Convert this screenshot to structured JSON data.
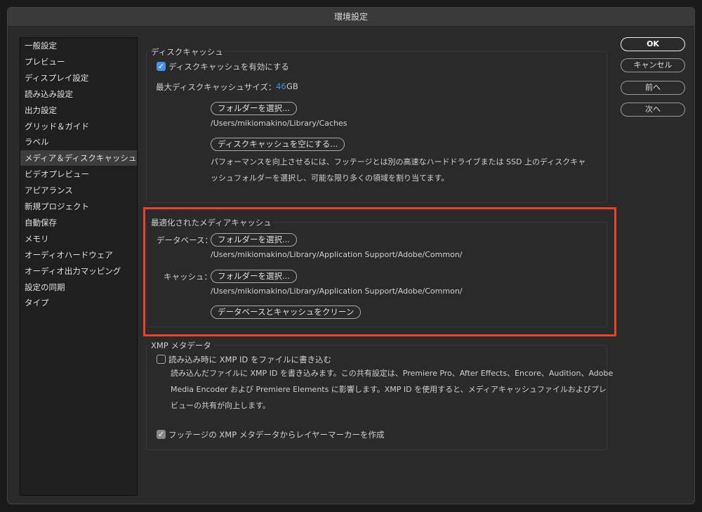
{
  "window": {
    "title": "環境設定"
  },
  "sidebar": {
    "items": [
      {
        "label": "一般設定"
      },
      {
        "label": "プレビュー"
      },
      {
        "label": "ディスプレイ設定"
      },
      {
        "label": "読み込み設定"
      },
      {
        "label": "出力設定"
      },
      {
        "label": "グリッド＆ガイド"
      },
      {
        "label": "ラベル"
      },
      {
        "label": "メディア＆ディスクキャッシュ",
        "selected": true
      },
      {
        "label": "ビデオプレビュー"
      },
      {
        "label": "アピアランス"
      },
      {
        "label": "新規プロジェクト"
      },
      {
        "label": "自動保存"
      },
      {
        "label": "メモリ"
      },
      {
        "label": "オーディオハードウェア"
      },
      {
        "label": "オーディオ出力マッピング"
      },
      {
        "label": "設定の同期"
      },
      {
        "label": "タイプ"
      }
    ]
  },
  "buttons": {
    "ok": "OK",
    "cancel": "キャンセル",
    "prev": "前へ",
    "next": "次へ"
  },
  "disk_cache": {
    "title": "ディスクキャッシュ",
    "enable_label": "ディスクキャッシュを有効にする",
    "enabled": true,
    "max_size_label": "最大ディスクキャッシュサイズ：",
    "max_size_value": "46",
    "max_size_unit": "GB",
    "choose_folder": "フォルダーを選択...",
    "folder_path": "/Users/mikiomakino/Library/Caches",
    "empty_button": "ディスクキャッシュを空にする...",
    "hint_line1": "パフォーマンスを向上させるには、フッテージとは別の高速なハードドライブまたは SSD 上のディスクキャ",
    "hint_line2": "ッシュフォルダーを選択し、可能な限り多くの領域を割り当てます。"
  },
  "optimized": {
    "title": "最適化されたメディアキャッシュ",
    "db_label": "データベース：",
    "db_button": "フォルダーを選択...",
    "db_path": "/Users/mikiomakino/Library/Application Support/Adobe/Common/",
    "cache_label": "キャッシュ：",
    "cache_button": "フォルダーを選択...",
    "cache_path": "/Users/mikiomakino/Library/Application Support/Adobe/Common/",
    "clean_button": "データベースとキャッシュをクリーン"
  },
  "xmp": {
    "title": "XMP メタデータ",
    "write_label": "読み込み時に XMP ID をファイルに書き込む",
    "write_checked": false,
    "desc_line1": "読み込んだファイルに XMP ID を書き込みます。この共有設定は、Premiere Pro、After Effects、Encore、Audition、Adobe",
    "desc_line2": "Media Encoder および Premiere Elements に影響します。XMP ID を使用すると、メディアキャッシュファイルおよびプレ",
    "desc_line3": "ビューの共有が向上します。",
    "marker_label": "フッテージの XMP メタデータからレイヤーマーカーを作成",
    "marker_checked": true
  },
  "colors": {
    "accent": "#4a8fe8",
    "highlight": "#e8442c"
  }
}
